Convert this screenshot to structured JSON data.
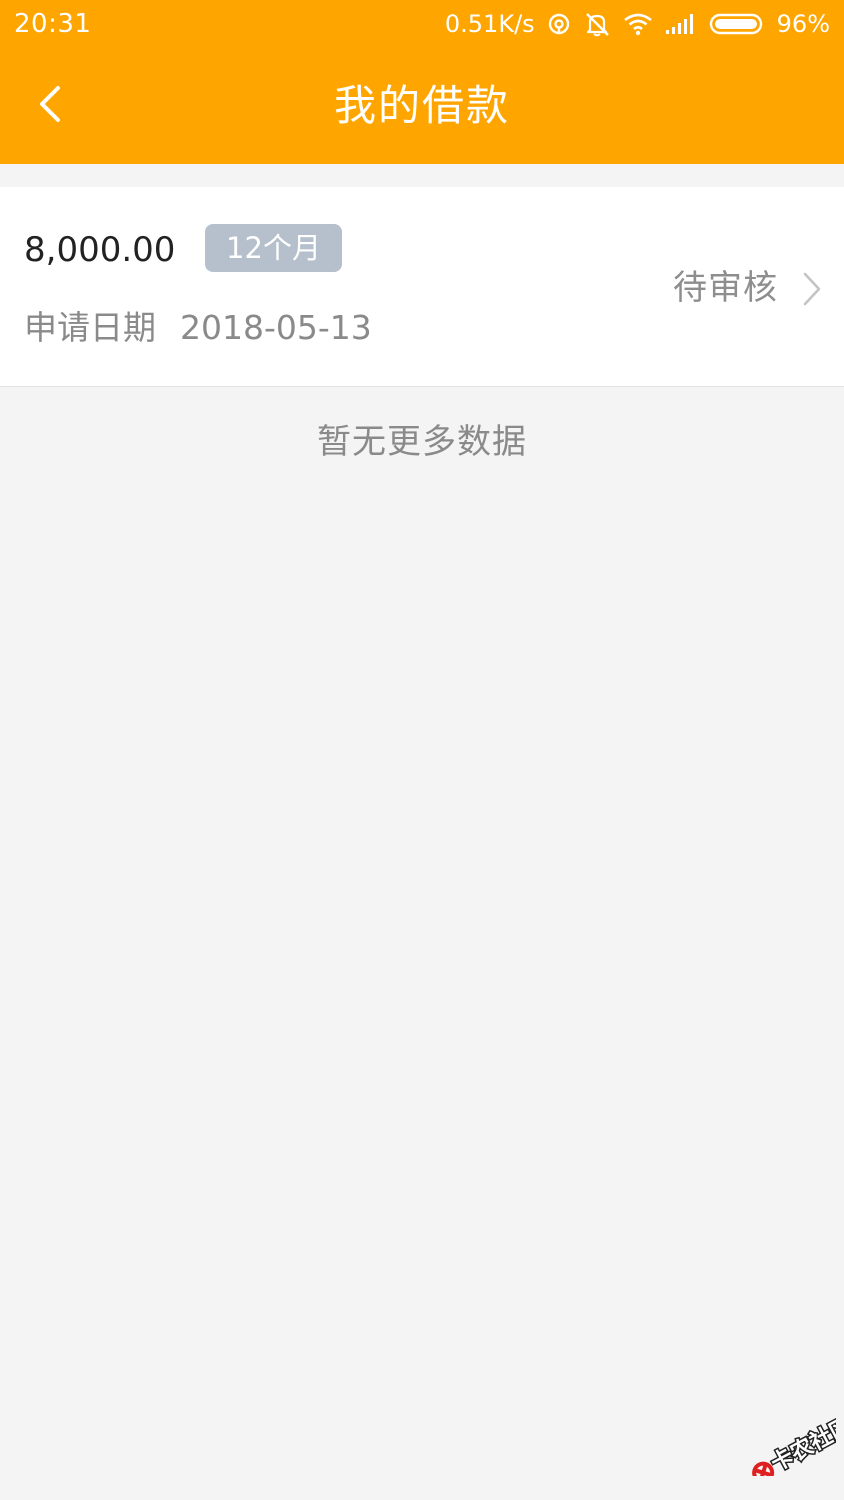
{
  "status_bar": {
    "time": "20:31",
    "network_speed": "0.51K/s",
    "battery": "96%",
    "icons": [
      "hotspot-icon",
      "mute-icon",
      "wifi-icon",
      "signal-icon",
      "battery-icon"
    ]
  },
  "header": {
    "back_icon": "chevron-left-icon",
    "title": "我的借款"
  },
  "loans": [
    {
      "amount": "8,000.00",
      "term": "12个月",
      "date_label": "申请日期",
      "date": "2018-05-13",
      "status": "待审核",
      "chevron_icon": "chevron-right-icon"
    }
  ],
  "list_footer": "暂无更多数据",
  "watermark": {
    "text": "卡农社区",
    "icon": "kanong-logo-icon"
  },
  "colors": {
    "header_bg": "#ffa500",
    "page_bg": "#f4f4f4",
    "badge_bg": "#b5c0cc",
    "watermark_red": "#e02020"
  }
}
